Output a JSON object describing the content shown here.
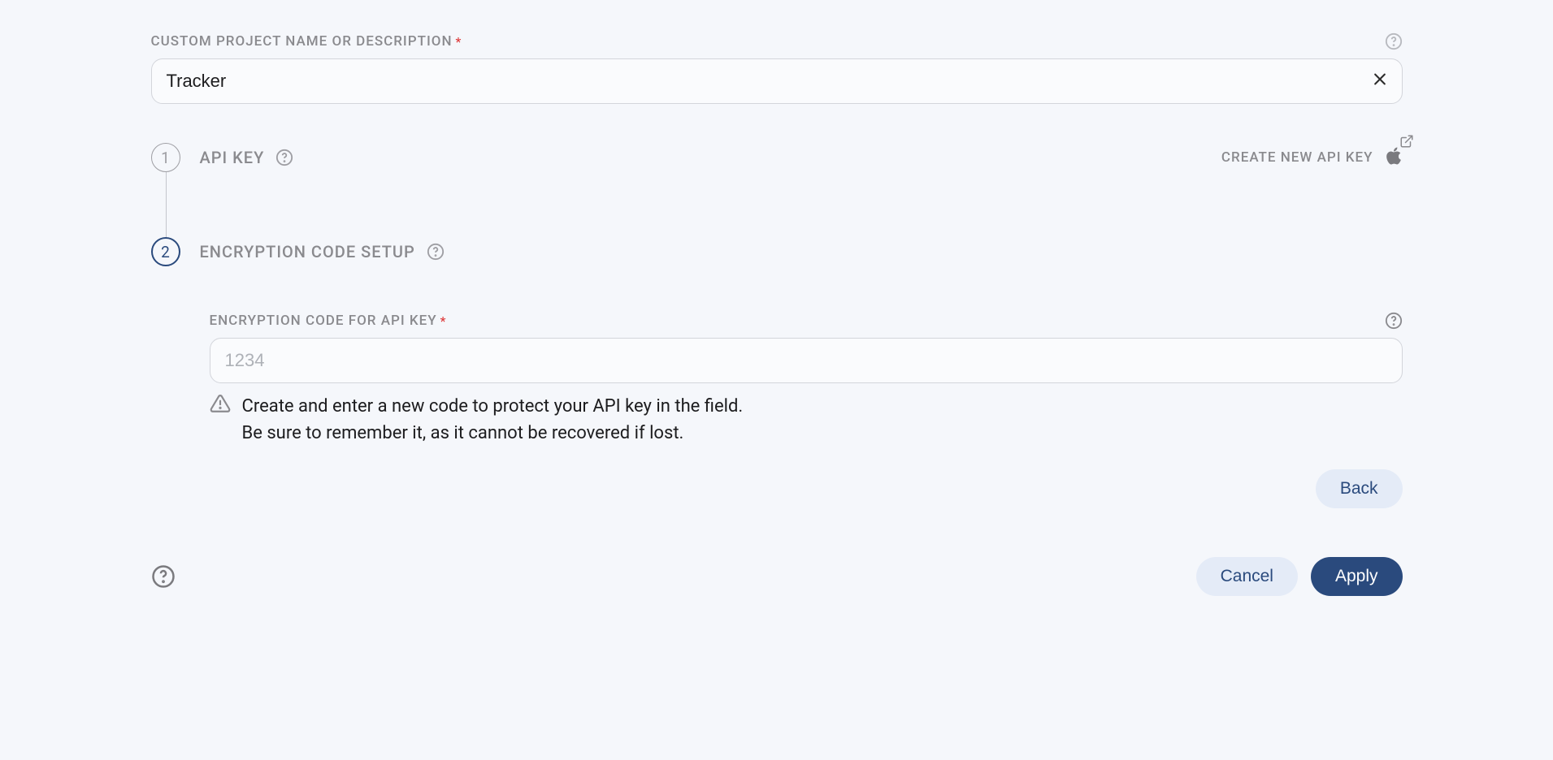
{
  "projectName": {
    "label": "CUSTOM PROJECT NAME OR DESCRIPTION",
    "value": "Tracker"
  },
  "steps": {
    "apiKey": {
      "num": "1",
      "title": "API KEY",
      "createLink": "CREATE NEW API KEY"
    },
    "encryption": {
      "num": "2",
      "title": "ENCRYPTION CODE SETUP",
      "fieldLabel": "ENCRYPTION CODE FOR API KEY",
      "placeholder": "1234",
      "hintLine1": "Create and enter a new code to protect your API key in the field.",
      "hintLine2": "Be sure to remember it, as it cannot be recovered if lost."
    }
  },
  "buttons": {
    "back": "Back",
    "cancel": "Cancel",
    "apply": "Apply"
  }
}
